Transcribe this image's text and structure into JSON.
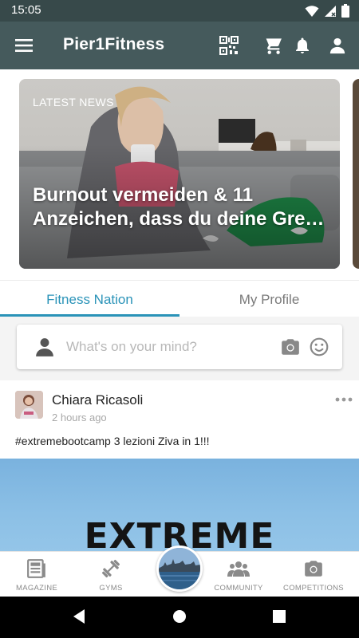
{
  "status_bar": {
    "time": "15:05",
    "icons": [
      "wifi-icon",
      "signal-icon",
      "battery-icon"
    ]
  },
  "app_bar": {
    "title": "Pier1Fitness",
    "background": "#455a5c",
    "actions": [
      "qr-code-icon",
      "cart-icon",
      "bell-icon",
      "profile-icon"
    ]
  },
  "news": {
    "label": "LATEST NEWS",
    "headline": "Burnout vermeiden & 11 Anzeichen, dass du deine Gre…"
  },
  "tabs": [
    {
      "label": "Fitness Nation",
      "active": true
    },
    {
      "label": "My Profile",
      "active": false
    }
  ],
  "composer": {
    "placeholder": "What's on your mind?"
  },
  "post": {
    "author": "Chiara Ricasoli",
    "time": "2 hours ago",
    "text": "#extremebootcamp 3 lezioni Ziva in 1!!!",
    "image_word": "EXTREME"
  },
  "bottom_nav": {
    "items": [
      {
        "label": "MAGAZINE",
        "icon": "magazine-icon"
      },
      {
        "label": "GYMS",
        "icon": "dumbbell-icon"
      },
      {
        "label": "COMMUNITY",
        "icon": "community-icon"
      },
      {
        "label": "COMPETITIONS",
        "icon": "camera-icon"
      }
    ]
  },
  "colors": {
    "accent": "#2a93b8",
    "toolbar": "#455a5c",
    "statusbar": "#37494a"
  }
}
